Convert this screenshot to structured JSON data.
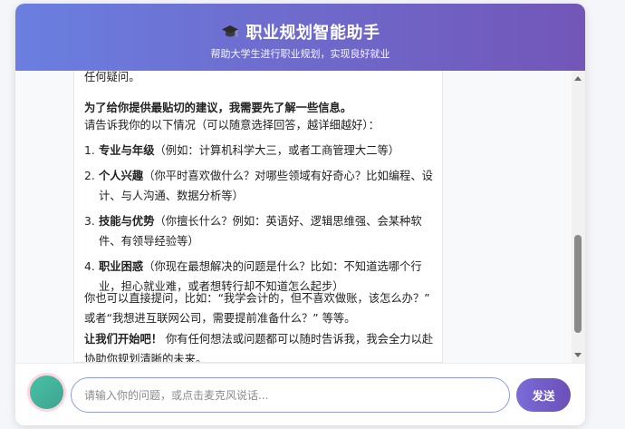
{
  "header": {
    "title": "职业规划智能助手",
    "subtitle": "帮助大学生进行职业规划，实现良好就业",
    "icon": "graduation-cap-icon"
  },
  "message": {
    "line_top": "任何疑问。",
    "intro_bold": "为了给你提供最贴切的建议，我需要先了解一些信息。",
    "intro_sub": "请告诉我你的以下情况（可以随意选择回答，越详细越好）：",
    "items": [
      {
        "num": "1.",
        "label": "专业与年级",
        "desc": "（例如：计算机科学大三，或者工商管理大二等）"
      },
      {
        "num": "2.",
        "label": "个人兴趣",
        "desc": "（你平时喜欢做什么？对哪些领域有好奇心？比如编程、设计、与人沟通、数据分析等）"
      },
      {
        "num": "3.",
        "label": "技能与优势",
        "desc": "（你擅长什么？例如：英语好、逻辑思维强、会某种软件、有领导经验等）"
      },
      {
        "num": "4.",
        "label": "职业困惑",
        "desc": "（你现在最想解决的问题是什么？比如：不知道选哪个行业，担心就业难，或者想转行却不知道怎么起步）"
      }
    ],
    "extra": "你也可以直接提问，比如：“我学会计的，但不喜欢做账，该怎么办？”  或者“我想进互联网公司，需要提前准备什么？” 等等。",
    "start_bold": "让我们开始吧！",
    "start_rest": " 你有任何想法或问题都可以随时告诉我，我会全力以赴协助你规划清晰的未来。"
  },
  "input": {
    "placeholder": "请输入你的问题，或点击麦克风说话...",
    "value": ""
  },
  "send_label": "发送",
  "mic_icon": "microphone-icon",
  "colors": {
    "header_start": "#6a7fe0",
    "header_end": "#7256b8",
    "send_button": "#7260c8",
    "mic_ring": "#ffd6e0",
    "mic_fill": "#48c2a8",
    "input_border": "#8e9be6"
  }
}
